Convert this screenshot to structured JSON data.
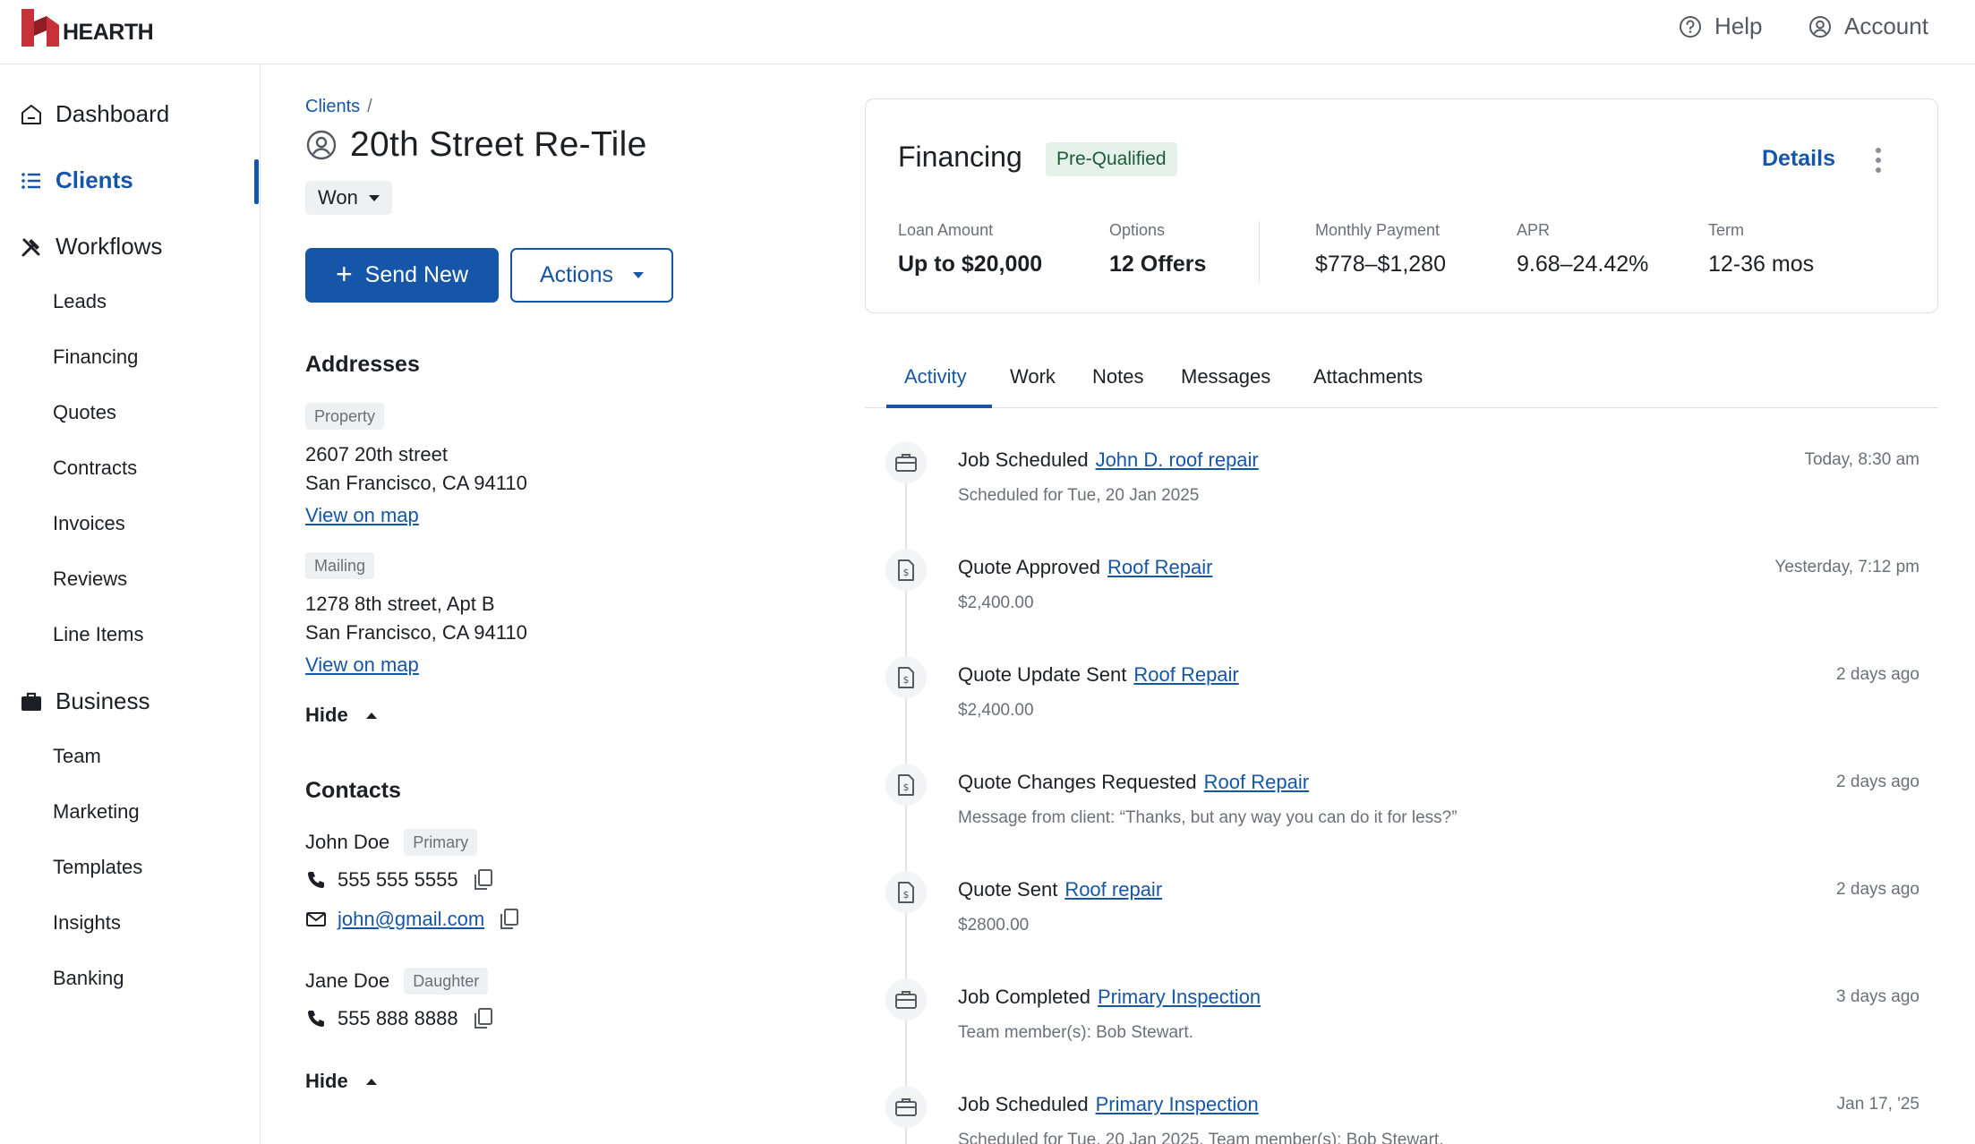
{
  "brand": {
    "name": "HEARTH"
  },
  "header": {
    "help_label": "Help",
    "account_label": "Account"
  },
  "sidebar": {
    "dashboard": "Dashboard",
    "clients": "Clients",
    "workflows": "Workflows",
    "workflow_items": [
      "Leads",
      "Financing",
      "Quotes",
      "Contracts",
      "Invoices",
      "Reviews",
      "Line Items"
    ],
    "business": "Business",
    "business_items": [
      "Team",
      "Marketing",
      "Templates",
      "Insights",
      "Banking"
    ]
  },
  "client": {
    "breadcrumb": "Clients",
    "breadcrumb_sep": "/",
    "title": "20th Street Re-Tile",
    "status": "Won",
    "send_new_label": "Send New",
    "actions_label": "Actions"
  },
  "addresses": {
    "heading": "Addresses",
    "items": [
      {
        "type": "Property",
        "line1": "2607 20th street",
        "line2": "San Francisco, CA 94110",
        "map_label": "View on map"
      },
      {
        "type": "Mailing",
        "line1": "1278 8th street, Apt B",
        "line2": "San Francisco, CA 94110",
        "map_label": "View on map"
      }
    ],
    "hide_label": "Hide"
  },
  "contacts": {
    "heading": "Contacts",
    "items": [
      {
        "name": "John Doe",
        "tag": "Primary",
        "phone": "555 555 5555",
        "email": "john@gmail.com"
      },
      {
        "name": "Jane Doe",
        "tag": "Daughter",
        "phone": "555 888 8888"
      }
    ],
    "hide_label": "Hide"
  },
  "financing": {
    "title": "Financing",
    "badge": "Pre-Qualified",
    "details_label": "Details",
    "stats": [
      {
        "label": "Loan Amount",
        "value": "Up to $20,000"
      },
      {
        "label": "Options",
        "value": "12 Offers"
      },
      {
        "label": "Monthly Payment",
        "value": "$778–$1,280"
      },
      {
        "label": "APR",
        "value": "9.68–24.42%"
      },
      {
        "label": "Term",
        "value": "12-36 mos"
      }
    ]
  },
  "tabs": [
    "Activity",
    "Work",
    "Notes",
    "Messages",
    "Attachments"
  ],
  "activity": [
    {
      "icon": "briefcase-icon",
      "title": "Job Scheduled",
      "link": "John D. roof repair",
      "sub": "Scheduled for Tue, 20 Jan 2025",
      "time": "Today, 8:30 am"
    },
    {
      "icon": "document-dollar-icon",
      "title": "Quote Approved",
      "link": "Roof Repair",
      "sub": "$2,400.00",
      "time": "Yesterday, 7:12 pm"
    },
    {
      "icon": "document-dollar-icon",
      "title": "Quote Update Sent",
      "link": "Roof Repair",
      "sub": "$2,400.00",
      "time": "2 days ago"
    },
    {
      "icon": "document-dollar-icon",
      "title": "Quote Changes Requested",
      "link": "Roof Repair",
      "sub": "Message from client: “Thanks, but any way you can do it for less?”",
      "time": "2 days ago"
    },
    {
      "icon": "document-dollar-icon",
      "title": "Quote Sent",
      "link": "Roof repair",
      "sub": "$2800.00",
      "time": "2 days ago"
    },
    {
      "icon": "briefcase-icon",
      "title": "Job Completed",
      "link": "Primary Inspection",
      "sub": "Team member(s): Bob Stewart.",
      "time": "3 days ago"
    },
    {
      "icon": "briefcase-icon",
      "title": "Job Scheduled",
      "link": "Primary Inspection",
      "sub": "Scheduled for Tue, 20 Jan 2025. Team member(s): Bob Stewart.",
      "time": "Jan 17, '25"
    }
  ],
  "colors": {
    "accent": "#1656a8",
    "brand_red": "#c8313a",
    "badge_green_bg": "#e5f2ea",
    "badge_green_text": "#1f5a37"
  }
}
